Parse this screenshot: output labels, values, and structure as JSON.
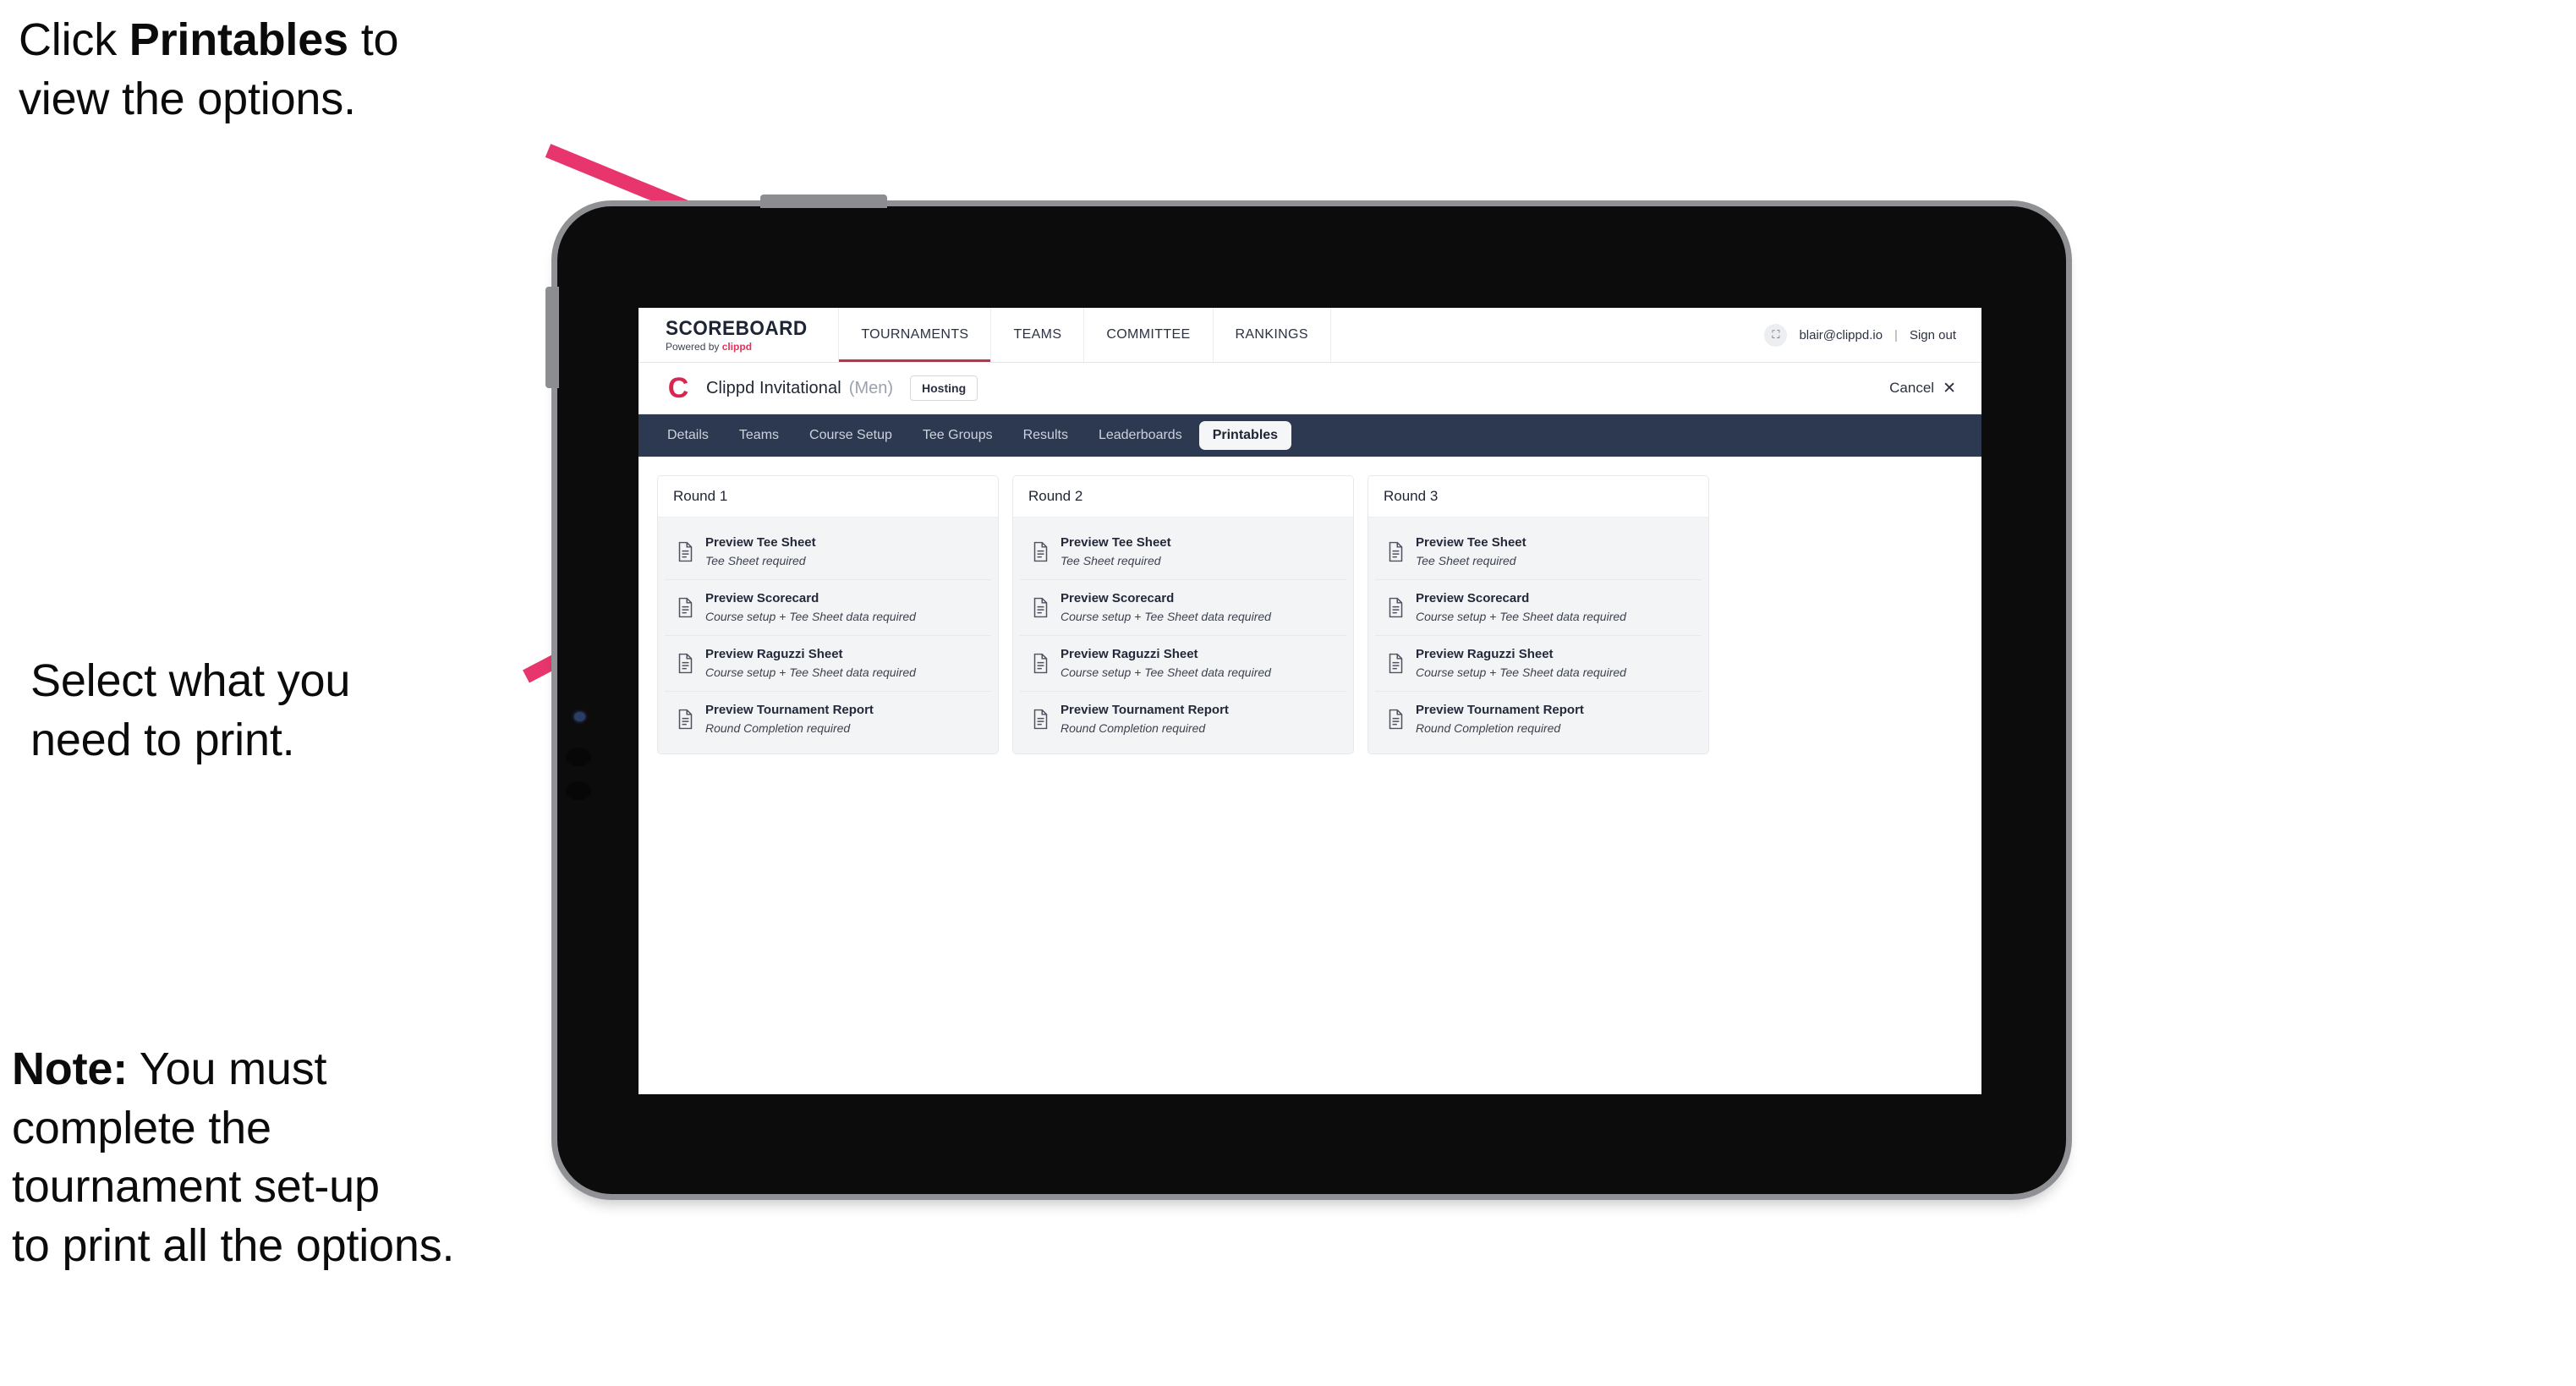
{
  "annotations": {
    "callout_printables": "Click ",
    "callout_printables_bold": "Printables",
    "callout_printables_tail": " to\nview the options.",
    "callout_select": "Select what you\n need to print.",
    "callout_note_bold": "Note:",
    "callout_note_rest": " You must\ncomplete the\ntournament set-up\nto print all the options.",
    "arrow_color": "#e8356d"
  },
  "app": {
    "brand": {
      "wordmark": "SCOREBOARD",
      "powered_by": "Powered by ",
      "powered_by_brand": "clippd"
    },
    "nav": [
      {
        "label": "TOURNAMENTS",
        "active": true
      },
      {
        "label": "TEAMS",
        "active": false
      },
      {
        "label": "COMMITTEE",
        "active": false
      },
      {
        "label": "RANKINGS",
        "active": false
      }
    ],
    "account": {
      "avatar_icon": "user-image-icon",
      "avatar_glyph": "⛶",
      "email": "blair@clippd.io",
      "divider": "|",
      "sign_out": "Sign out"
    },
    "tournament": {
      "logo_letter": "C",
      "name": "Clippd Invitational",
      "gender": "(Men)",
      "status_badge": "Hosting",
      "cancel_label": "Cancel",
      "cancel_icon": "✕"
    },
    "section_tabs": [
      {
        "label": "Details",
        "active": false
      },
      {
        "label": "Teams",
        "active": false
      },
      {
        "label": "Course Setup",
        "active": false
      },
      {
        "label": "Tee Groups",
        "active": false
      },
      {
        "label": "Results",
        "active": false
      },
      {
        "label": "Leaderboards",
        "active": false
      },
      {
        "label": "Printables",
        "active": true
      }
    ],
    "printables": {
      "columns": [
        {
          "header": "Round 1",
          "items": [
            {
              "title": "Preview Tee Sheet",
              "subtitle": "Tee Sheet required"
            },
            {
              "title": "Preview Scorecard",
              "subtitle": "Course setup + Tee Sheet data required"
            },
            {
              "title": "Preview Raguzzi Sheet",
              "subtitle": "Course setup + Tee Sheet data required"
            },
            {
              "title": "Preview Tournament Report",
              "subtitle": "Round Completion required"
            }
          ]
        },
        {
          "header": "Round 2",
          "items": [
            {
              "title": "Preview Tee Sheet",
              "subtitle": "Tee Sheet required"
            },
            {
              "title": "Preview Scorecard",
              "subtitle": "Course setup + Tee Sheet data required"
            },
            {
              "title": "Preview Raguzzi Sheet",
              "subtitle": "Course setup + Tee Sheet data required"
            },
            {
              "title": "Preview Tournament Report",
              "subtitle": "Round Completion required"
            }
          ]
        },
        {
          "header": "Round 3",
          "items": [
            {
              "title": "Preview Tee Sheet",
              "subtitle": "Tee Sheet required"
            },
            {
              "title": "Preview Scorecard",
              "subtitle": "Course setup + Tee Sheet data required"
            },
            {
              "title": "Preview Raguzzi Sheet",
              "subtitle": "Course setup + Tee Sheet data required"
            },
            {
              "title": "Preview Tournament Report",
              "subtitle": "Round Completion required"
            }
          ]
        }
      ]
    }
  },
  "theme": {
    "tab_bar_bg": "#2d3950",
    "brand_red": "#e4315b",
    "accent_underline": "#c0314f"
  }
}
